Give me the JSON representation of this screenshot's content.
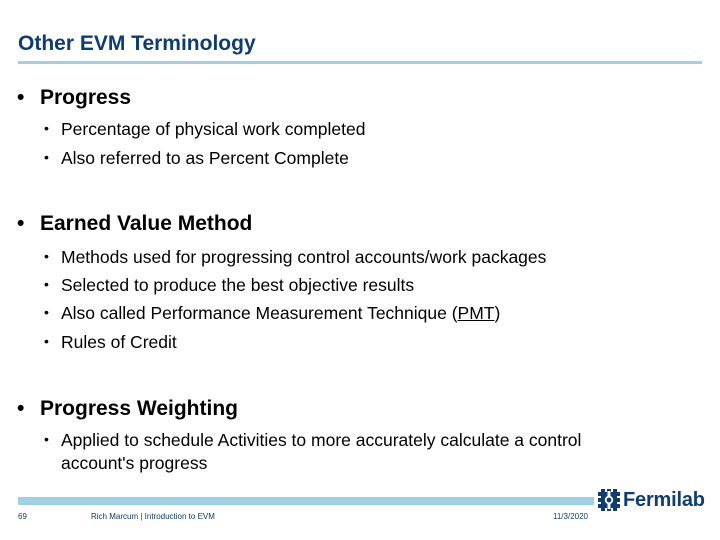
{
  "slide": {
    "title": "Other EVM Terminology",
    "accent_color": "#9fd0e2",
    "title_color": "#0f3d6e"
  },
  "sections": [
    {
      "heading": "Progress",
      "items": [
        {
          "text": "Percentage of physical work completed"
        },
        {
          "text": "Also referred to as Percent Complete"
        }
      ]
    },
    {
      "heading": "Earned Value Method",
      "items": [
        {
          "text": "Methods used for progressing control accounts/work packages"
        },
        {
          "text": "Selected to produce the best objective results"
        },
        {
          "text_before": "Also called Performance Measurement Technique (",
          "link": "PMT",
          "text_after": ")"
        },
        {
          "text": "Rules of Credit"
        }
      ]
    },
    {
      "heading": "Progress Weighting",
      "items": [
        {
          "text_line1": "Applied to schedule Activities to more accurately calculate a control",
          "text_line2": "account's progress"
        }
      ]
    }
  ],
  "bullet_glyph": "•",
  "footer": {
    "page_number": "69",
    "presenter": "Rich Marcum | Introduction to EVM",
    "date": "11/3/2020",
    "logo_text": "Fermilab",
    "logo_icon": "fermilab-gear-icon"
  }
}
